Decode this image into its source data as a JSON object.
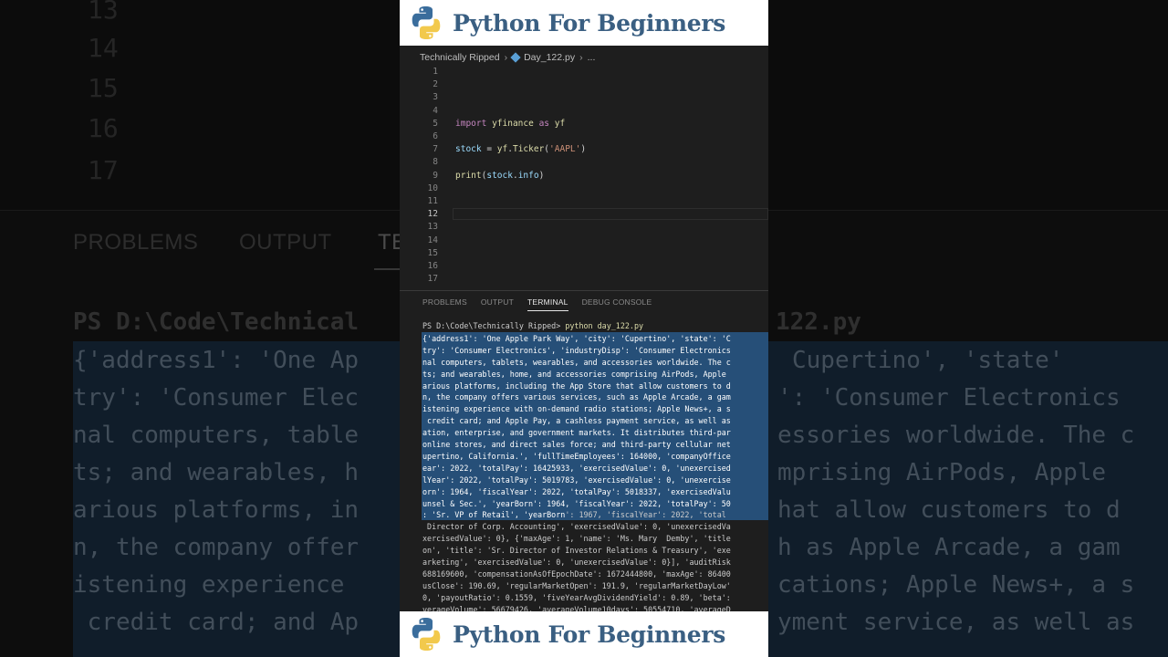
{
  "brand": {
    "title": "Python For Beginners",
    "colors": {
      "title": "#3a5f82",
      "logo_blue": "#3a6d9c",
      "logo_yellow": "#f2c94c"
    }
  },
  "background": {
    "line_numbers": [
      "13",
      "14",
      "15",
      "16",
      "17"
    ],
    "tabs": [
      "PROBLEMS",
      "OUTPUT",
      "TE"
    ],
    "prompt": "PS D:\\Code\\Technical",
    "prompt_tail": "122.py",
    "lines": [
      "{'address1': 'One Ap",
      "try': 'Consumer Elec",
      "nal computers, table",
      "ts; and wearables, h",
      "arious platforms, in",
      "n, the company offer",
      "istening experience",
      " credit card; and Ap"
    ],
    "right_lines": [
      "Cupertino', 'state'",
      "': 'Consumer Electronics",
      "essories worldwide. The c",
      "mprising AirPods, Apple",
      "hat allow customers to d",
      "h as Apple Arcade, a gam",
      "cations; Apple News+, a s",
      "yment service, as well as"
    ]
  },
  "breadcrumb": {
    "folder": "Technically Ripped",
    "file": "Day_122.py",
    "more": "..."
  },
  "editor": {
    "active_line": 12,
    "lines": [
      {
        "n": "1",
        "code": ""
      },
      {
        "n": "2",
        "code": ""
      },
      {
        "n": "3",
        "code": ""
      },
      {
        "n": "4",
        "code": ""
      },
      {
        "n": "5",
        "tokens": [
          [
            "kw",
            "import"
          ],
          [
            "p",
            " "
          ],
          [
            "mod",
            "yfinance"
          ],
          [
            "p",
            " "
          ],
          [
            "kw",
            "as"
          ],
          [
            "p",
            " "
          ],
          [
            "mod",
            "yf"
          ]
        ]
      },
      {
        "n": "6",
        "code": ""
      },
      {
        "n": "7",
        "tokens": [
          [
            "id",
            "stock"
          ],
          [
            "p",
            " = "
          ],
          [
            "mod",
            "yf"
          ],
          [
            "p",
            "."
          ],
          [
            "fn",
            "Ticker"
          ],
          [
            "p",
            "("
          ],
          [
            "str",
            "'AAPL'"
          ],
          [
            "p",
            ")"
          ]
        ]
      },
      {
        "n": "8",
        "code": ""
      },
      {
        "n": "9",
        "tokens": [
          [
            "fn",
            "print"
          ],
          [
            "p",
            "("
          ],
          [
            "id",
            "stock"
          ],
          [
            "p",
            "."
          ],
          [
            "id",
            "info"
          ],
          [
            "p",
            ")"
          ]
        ]
      },
      {
        "n": "10",
        "code": ""
      },
      {
        "n": "11",
        "code": ""
      },
      {
        "n": "12",
        "code": ""
      },
      {
        "n": "13",
        "code": ""
      },
      {
        "n": "14",
        "code": ""
      },
      {
        "n": "15",
        "code": ""
      },
      {
        "n": "16",
        "code": ""
      },
      {
        "n": "17",
        "code": ""
      }
    ]
  },
  "panel": {
    "tabs": [
      "PROBLEMS",
      "OUTPUT",
      "TERMINAL",
      "DEBUG CONSOLE"
    ],
    "active_tab": "TERMINAL"
  },
  "terminal": {
    "prompt": "PS D:\\Code\\Technically Ripped>",
    "command": "python day_122.py",
    "selected_lines": [
      "{'address1': 'One Apple Park Way', 'city': 'Cupertino', 'state': 'C",
      "try': 'Consumer Electronics', 'industryDisp': 'Consumer Electronics",
      "nal computers, tablets, wearables, and accessories worldwide. The c",
      "ts; and wearables, home, and accessories comprising AirPods, Apple",
      "arious platforms, including the App Store that allow customers to d",
      "n, the company offers various services, such as Apple Arcade, a gam",
      "istening experience with on-demand radio stations; Apple News+, a s",
      " credit card; and Apple Pay, a cashless payment service, as well as",
      "ation, enterprise, and government markets. It distributes third-par",
      "online stores, and direct sales force; and third-party cellular net",
      "upertino, California.', 'fullTimeEmployees': 164000, 'companyOffice",
      "ear': 2022, 'totalPay': 16425933, 'exercisedValue': 0, 'unexercised",
      "lYear': 2022, 'totalPay': 5019783, 'exercisedValue': 0, 'unexercise",
      "orn': 1964, 'fiscalYear': 2022, 'totalPay': 5018337, 'exercisedValu",
      "unsel & Sec.', 'yearBorn': 1964, 'fiscalYear': 2022, 'totalPay': 50"
    ],
    "partial_selected": ": 'Sr. VP of Retail', 'yearBorn",
    "partial_rest": "': 1967, 'fiscalYear': 2022, 'total",
    "rest_lines": [
      " Director of Corp. Accounting', 'exercisedValue': 0, 'unexercisedVa",
      "xercisedValue': 0}, {'maxAge': 1, 'name': 'Ms. Mary  Demby', 'title",
      "on', 'title': 'Sr. Director of Investor Relations & Treasury', 'exe",
      "arketing', 'exercisedValue': 0, 'unexercisedValue': 0}], 'auditRisk",
      "688169600, 'compensationAsOfEpochDate': 1672444800, 'maxAge': 86400",
      "usClose': 190.69, 'regularMarketOpen': 191.9, 'regularMarketDayLow'",
      "0, 'payoutRatio': 0.1559, 'fiveYearAvgDividendYield': 0.89, 'beta':",
      "verageVolume': 56679426, 'averageVolume10days': 50554710, 'averageD"
    ]
  }
}
